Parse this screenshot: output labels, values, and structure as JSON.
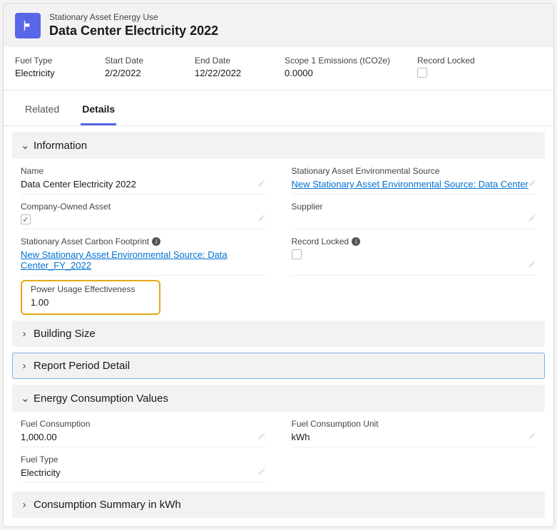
{
  "header": {
    "object_label": "Stationary Asset Energy Use",
    "title": "Data Center Electricity 2022"
  },
  "summary": {
    "fuel_type": {
      "label": "Fuel Type",
      "value": "Electricity"
    },
    "start_date": {
      "label": "Start Date",
      "value": "2/2/2022"
    },
    "end_date": {
      "label": "End Date",
      "value": "12/22/2022"
    },
    "scope1": {
      "label": "Scope 1 Emissions (tCO2e)",
      "value": "0.0000"
    },
    "record_locked": {
      "label": "Record Locked",
      "checked": false
    }
  },
  "tabs": {
    "related": "Related",
    "details": "Details"
  },
  "sections": {
    "information": {
      "title": "Information",
      "name": {
        "label": "Name",
        "value": "Data Center Electricity 2022"
      },
      "env_source": {
        "label": "Stationary Asset Environmental Source",
        "value": "New Stationary Asset Environmental Source: Data Center"
      },
      "company_owned": {
        "label": "Company-Owned Asset",
        "checked": true
      },
      "supplier": {
        "label": "Supplier",
        "value": ""
      },
      "carbon_footprint": {
        "label": "Stationary Asset Carbon Footprint",
        "value": "New Stationary Asset Environmental Source: Data Center_FY_2022"
      },
      "record_locked": {
        "label": "Record Locked",
        "checked": false
      },
      "pue": {
        "label": "Power Usage Effectiveness",
        "value": "1.00"
      }
    },
    "building_size": {
      "title": "Building Size"
    },
    "report_period": {
      "title": "Report Period Detail"
    },
    "energy_consumption": {
      "title": "Energy Consumption Values",
      "fuel_consumption": {
        "label": "Fuel Consumption",
        "value": "1,000.00"
      },
      "fuel_consumption_unit": {
        "label": "Fuel Consumption Unit",
        "value": "kWh"
      },
      "fuel_type": {
        "label": "Fuel Type",
        "value": "Electricity"
      }
    },
    "consumption_summary": {
      "title": "Consumption Summary in kWh"
    }
  }
}
